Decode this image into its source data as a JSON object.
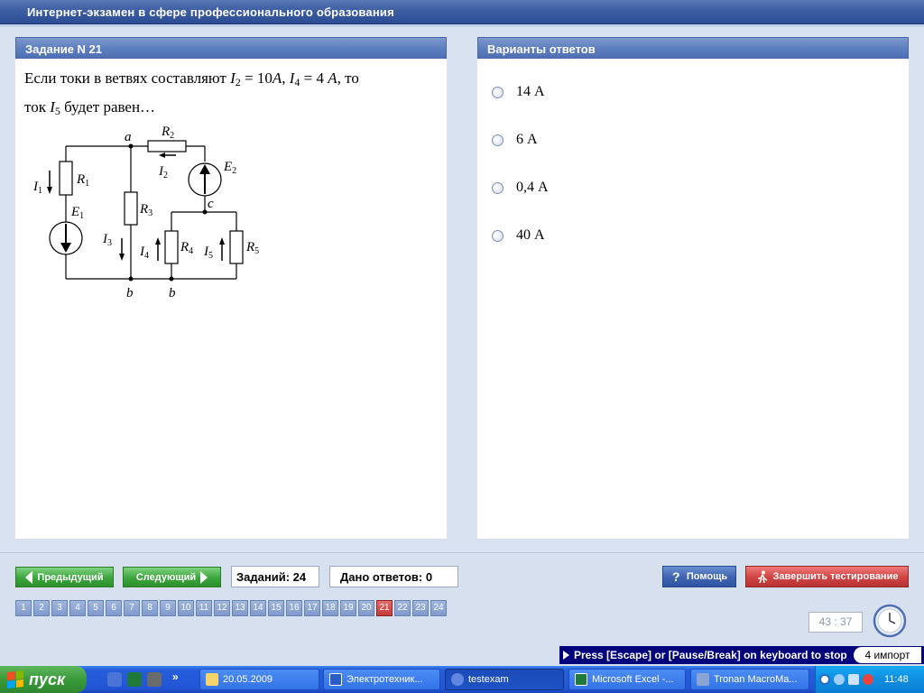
{
  "window": {
    "title": "Интернет-экзамен в сфере профессионального образования"
  },
  "task": {
    "header": "Задание N 21",
    "text_before": "Если токи в ветвях составляют",
    "text_mid": ", то",
    "text_line2_start": "ток",
    "text_line2_end": "будет равен…",
    "i2_value": "10",
    "i4_value": "4",
    "unit": "A"
  },
  "circuit": {
    "nodes": {
      "a": "a",
      "b1": "b",
      "b2": "b",
      "c": "c"
    },
    "labels": {
      "R1": "R",
      "R2": "R",
      "R3": "R",
      "R4": "R",
      "R5": "R",
      "E1": "E",
      "E2": "E",
      "I1": "I",
      "I2": "I",
      "I3": "I",
      "I4": "I",
      "I5": "I"
    },
    "subs": {
      "R1": "1",
      "R2": "2",
      "R3": "3",
      "R4": "4",
      "R5": "5",
      "E1": "1",
      "E2": "2",
      "I1": "1",
      "I2": "2",
      "I3": "3",
      "I4": "4",
      "I5": "5"
    }
  },
  "answers": {
    "header": "Варианты ответов",
    "options": [
      {
        "label": "14 А"
      },
      {
        "label": "6 А"
      },
      {
        "label": "0,4 А"
      },
      {
        "label": "40 А"
      }
    ]
  },
  "navigation": {
    "prev_label": "Предыдущий",
    "next_label": "Следующий",
    "total_tasks": "Заданий: 24",
    "answered": "Дано ответов: 0",
    "help_label": "Помощь",
    "finish_label": "Завершить тестирование",
    "question_numbers": [
      "1",
      "2",
      "3",
      "4",
      "5",
      "6",
      "7",
      "8",
      "9",
      "10",
      "11",
      "12",
      "13",
      "14",
      "15",
      "16",
      "17",
      "18",
      "19",
      "20",
      "21",
      "22",
      "23",
      "24"
    ],
    "current_question": "21"
  },
  "timer": {
    "value": "43 : 37"
  },
  "macro_bar": {
    "message": "Press [Escape] or [Pause/Break] on keyboard to stop",
    "badge": "4 импорт"
  },
  "taskbar": {
    "start_label": "пуск",
    "tasks": [
      {
        "label": "20.05.2009",
        "icon_color": "#f5d56b"
      },
      {
        "label": "Электротехник...",
        "icon_color": "#2b5fc6"
      },
      {
        "label": "testexam",
        "icon_color": "#2f5fd0"
      },
      {
        "label": "Microsoft Excel -...",
        "icon_color": "#1f7a3a"
      },
      {
        "label": "Tronan MacroMa...",
        "icon_color": "#8aa4d8"
      }
    ],
    "clock": "11:48"
  }
}
